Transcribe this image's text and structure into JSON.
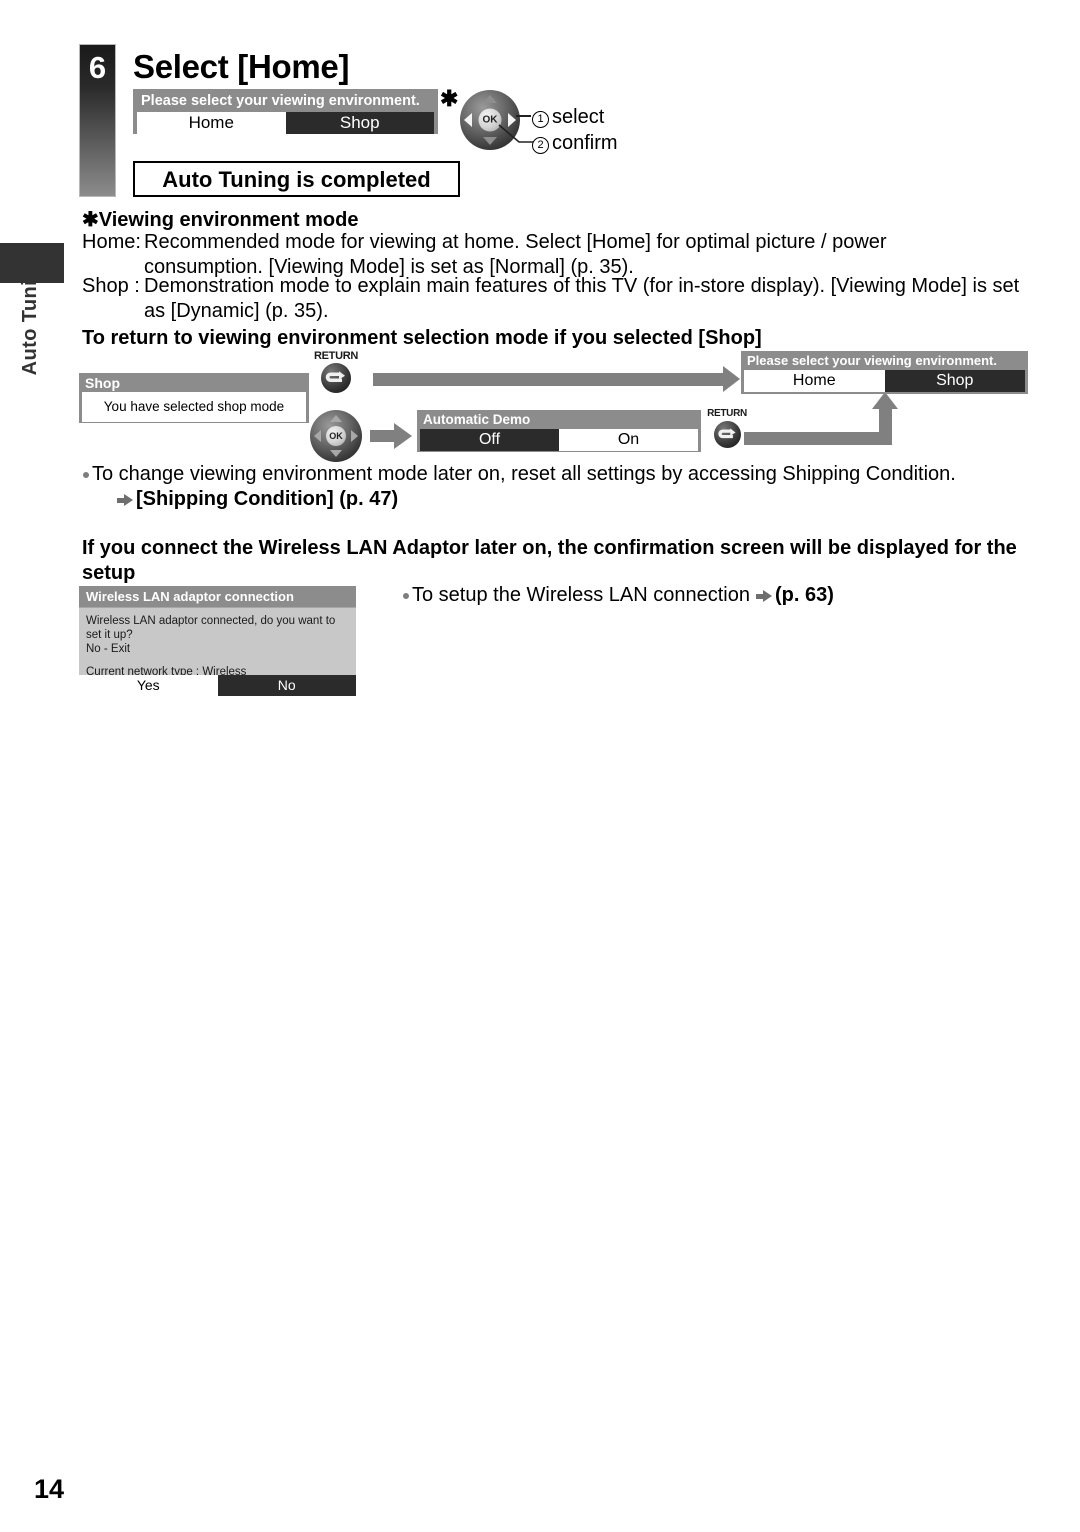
{
  "sidebar": {
    "chapter_label": "Auto Tuning"
  },
  "step": {
    "number": "6",
    "title": "Select [Home]"
  },
  "top_dialog": {
    "title": "Please select your viewing environment.",
    "options": [
      {
        "label": "Home",
        "state": "light"
      },
      {
        "label": "Shop",
        "state": "dark"
      }
    ],
    "asterisk": "✱"
  },
  "remote_top": {
    "ok_label": "OK",
    "callouts": [
      {
        "num": "①",
        "label": "select"
      },
      {
        "num": "②",
        "label": "confirm"
      }
    ]
  },
  "completed_box": {
    "text": "Auto Tuning is completed"
  },
  "mode_section": {
    "heading": "✱Viewing environment mode",
    "rows": [
      {
        "label": "Home:",
        "body": "Recommended mode for viewing at home. Select [Home] for optimal picture / power consumption. [Viewing Mode] is set as [Normal] (p. 35)."
      },
      {
        "label": "Shop :",
        "body": "Demonstration mode to explain main features of this TV (for in-store display). [Viewing Mode] is set as [Dynamic] (p. 35)."
      }
    ]
  },
  "return_section": {
    "heading": "To return to viewing environment selection mode if you selected [Shop]",
    "shop_dialog": {
      "title": "Shop",
      "body": "You have selected shop mode"
    },
    "return_button_1": {
      "label": "RETURN",
      "icon": "return-arrow-icon"
    },
    "remote_flow": {
      "ok_label": "OK"
    },
    "demo_dialog": {
      "title": "Automatic Demo",
      "options": [
        {
          "label": "Off",
          "state": "dark"
        },
        {
          "label": "On",
          "state": "light"
        }
      ]
    },
    "return_button_2": {
      "label": "RETURN",
      "icon": "return-arrow-icon"
    },
    "env_dialog": {
      "title": "Please select your viewing environment.",
      "options": [
        {
          "label": "Home",
          "state": "light"
        },
        {
          "label": "Shop",
          "state": "dark"
        }
      ]
    }
  },
  "notes": {
    "note1": "To change viewing environment mode later on, reset all settings by accessing Shipping Condition.",
    "note1_sub": "[Shipping Condition] (p. 47)",
    "wlan_heading": "If you connect the Wireless LAN Adaptor later on, the confirmation screen will be displayed for the setup",
    "note2_prefix": "To setup the Wireless LAN connection",
    "note2_page": "(p. 63)"
  },
  "wlan_dialog": {
    "title": "Wireless LAN adaptor connection",
    "line1": "Wireless LAN adaptor connected, do you want to set it up?",
    "line2": "No - Exit",
    "line3": "Current network type : Wireless",
    "options": [
      {
        "label": "Yes",
        "state": "light"
      },
      {
        "label": "No",
        "state": "dark"
      }
    ]
  },
  "page": {
    "number": "14"
  },
  "colors": {
    "dialog_bg": "#8c8c8c",
    "dialog_selected": "#2b2b2b",
    "arrow": "#808080",
    "sidebar_tab": "#333333"
  }
}
